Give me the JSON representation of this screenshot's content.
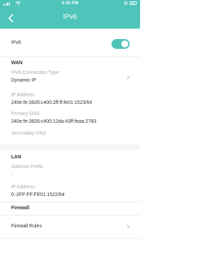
{
  "status_bar": {
    "time": "4:26 PM"
  },
  "nav": {
    "title": "IPv6"
  },
  "ipv6_toggle": {
    "label": "IPv6",
    "enabled": true
  },
  "wan": {
    "header": "WAN",
    "connection_type_label": "IPv6 Connection Type",
    "connection_type_value": "Dynamic IP",
    "ip_address_label": "IP Address",
    "ip_address_value": "240e:fe:3826:c400:2ff:ff:fe01:1523/64",
    "primary_dns_label": "Primary DNS",
    "primary_dns_value": "240e:fe:3826:c400:12da:43ff:feaa:2783",
    "secondary_dns_label": "Secondary DNS"
  },
  "lan": {
    "header": "LAN",
    "address_prefix_label": "Address Prefix",
    "address_prefix_value": "::",
    "ip_address_label": "IP Address",
    "ip_address_value": "0::2FF:FF:FE01:1522/64"
  },
  "firewall": {
    "header": "Firewall",
    "rules_label": "Firewall Rules"
  },
  "colors": {
    "accent": "#4fc4ba",
    "muted_text": "#aaaaaa",
    "text": "#333333"
  },
  "icons": [
    "signal-icon",
    "wifi-icon",
    "alarm-icon",
    "battery-icon",
    "back-arrow-icon",
    "chevron-right-icon"
  ]
}
